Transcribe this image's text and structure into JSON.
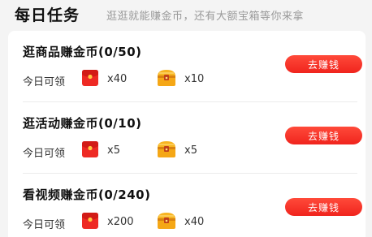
{
  "header": {
    "title": "每日任务",
    "subtitle": "逛逛就能赚金币，还有大额宝箱等你来拿"
  },
  "tasks": [
    {
      "title": "逛商品赚金币(0/50)",
      "today_label": "今日可领",
      "red_packet_count": "x40",
      "chest_count": "x10",
      "button_label": "去赚钱"
    },
    {
      "title": "逛活动赚金币(0/10)",
      "today_label": "今日可领",
      "red_packet_count": "x5",
      "chest_count": "x5",
      "button_label": "去赚钱"
    },
    {
      "title": "看视频赚金币(0/240)",
      "today_label": "今日可领",
      "red_packet_count": "x200",
      "chest_count": "x40",
      "button_label": "去赚钱"
    }
  ],
  "colors": {
    "accent_red": "#f0241d",
    "chest_gold": "#f5b21a",
    "background": "#f4f4f4"
  },
  "icons": {
    "red_packet": "red-packet-icon",
    "chest": "treasure-chest-icon"
  }
}
